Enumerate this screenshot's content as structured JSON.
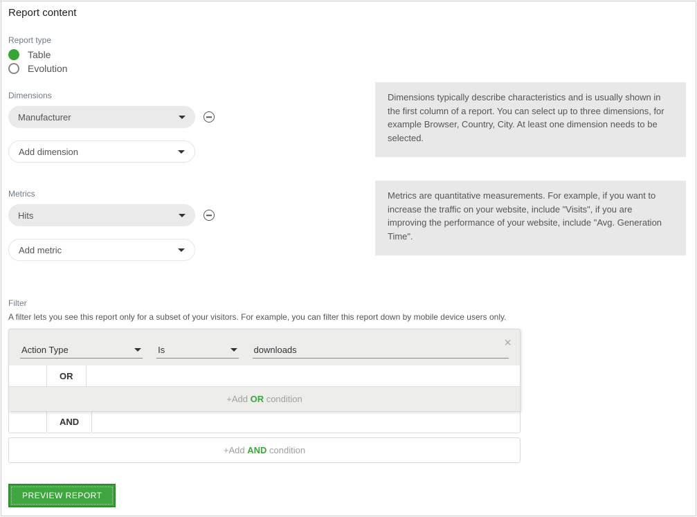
{
  "panel": {
    "title": "Report content"
  },
  "reportType": {
    "label": "Report type",
    "options": [
      {
        "label": "Table",
        "selected": true
      },
      {
        "label": "Evolution",
        "selected": false
      }
    ]
  },
  "dimensions": {
    "label": "Dimensions",
    "help": "Dimensions typically describe characteristics and is usually shown in the first column of a report. You can select up to three dimensions, for example Browser, Country, City. At least one dimension needs to be selected.",
    "selected": "Manufacturer",
    "addLabel": "Add dimension"
  },
  "metrics": {
    "label": "Metrics",
    "help": "Metrics are quantitative measurements. For example, if you want to increase the traffic on your website, include \"Visits\", if you are improving the performance of your website, include \"Avg. Generation Time\".",
    "selected": "Hits",
    "addLabel": "Add metric"
  },
  "filter": {
    "label": "Filter",
    "description": "A filter lets you see this report only for a subset of your visitors. For example, you can filter this report down by mobile device users only.",
    "condition": {
      "field": "Action Type",
      "operator": "Is",
      "value": "downloads"
    },
    "orLabel": "OR",
    "andLabel": "AND",
    "addOrPrefix": "+Add ",
    "addOrKeyword": "OR",
    "addOrSuffix": " condition",
    "addAndPrefix": "+Add ",
    "addAndKeyword": "AND",
    "addAndSuffix": " condition"
  },
  "actions": {
    "preview": "PREVIEW REPORT"
  }
}
